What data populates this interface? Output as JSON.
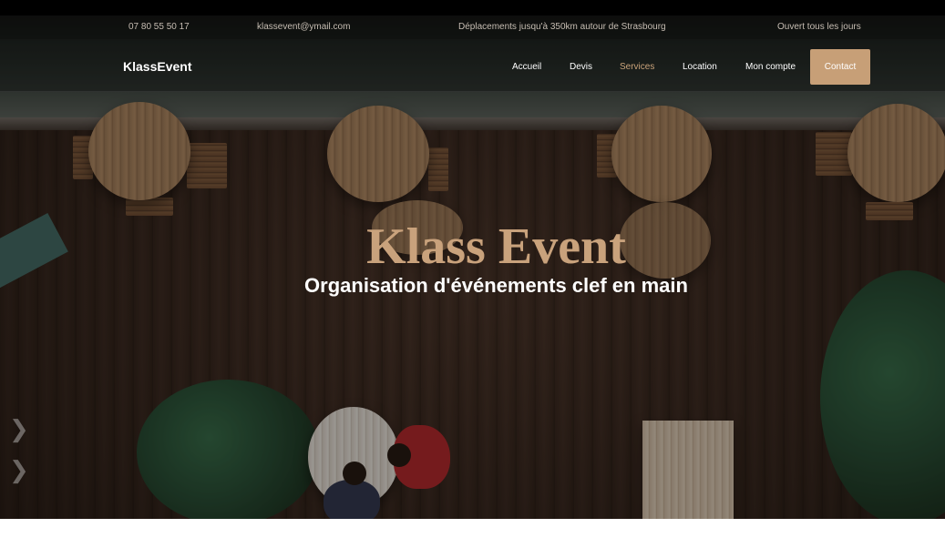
{
  "topbar": {
    "phone": "07 80 55 50 17",
    "email": "klassevent@ymail.com",
    "area": "Déplacements jusqu'à 350km autour de Strasbourg",
    "hours": "Ouvert tous les jours"
  },
  "nav": {
    "brand": "KlassEvent",
    "items": [
      {
        "label": "Accueil"
      },
      {
        "label": "Devis"
      },
      {
        "label": "Services"
      },
      {
        "label": "Location"
      },
      {
        "label": "Mon compte"
      }
    ],
    "cta": "Contact",
    "active_item": "Services",
    "accent_color": "#c79f77"
  },
  "hero": {
    "title": "Klass Event",
    "subtitle": "Organisation d'événements clef en main",
    "title_color": "#c9a27c"
  },
  "icons": {
    "carousel_prev": "chevron-right-icon"
  }
}
